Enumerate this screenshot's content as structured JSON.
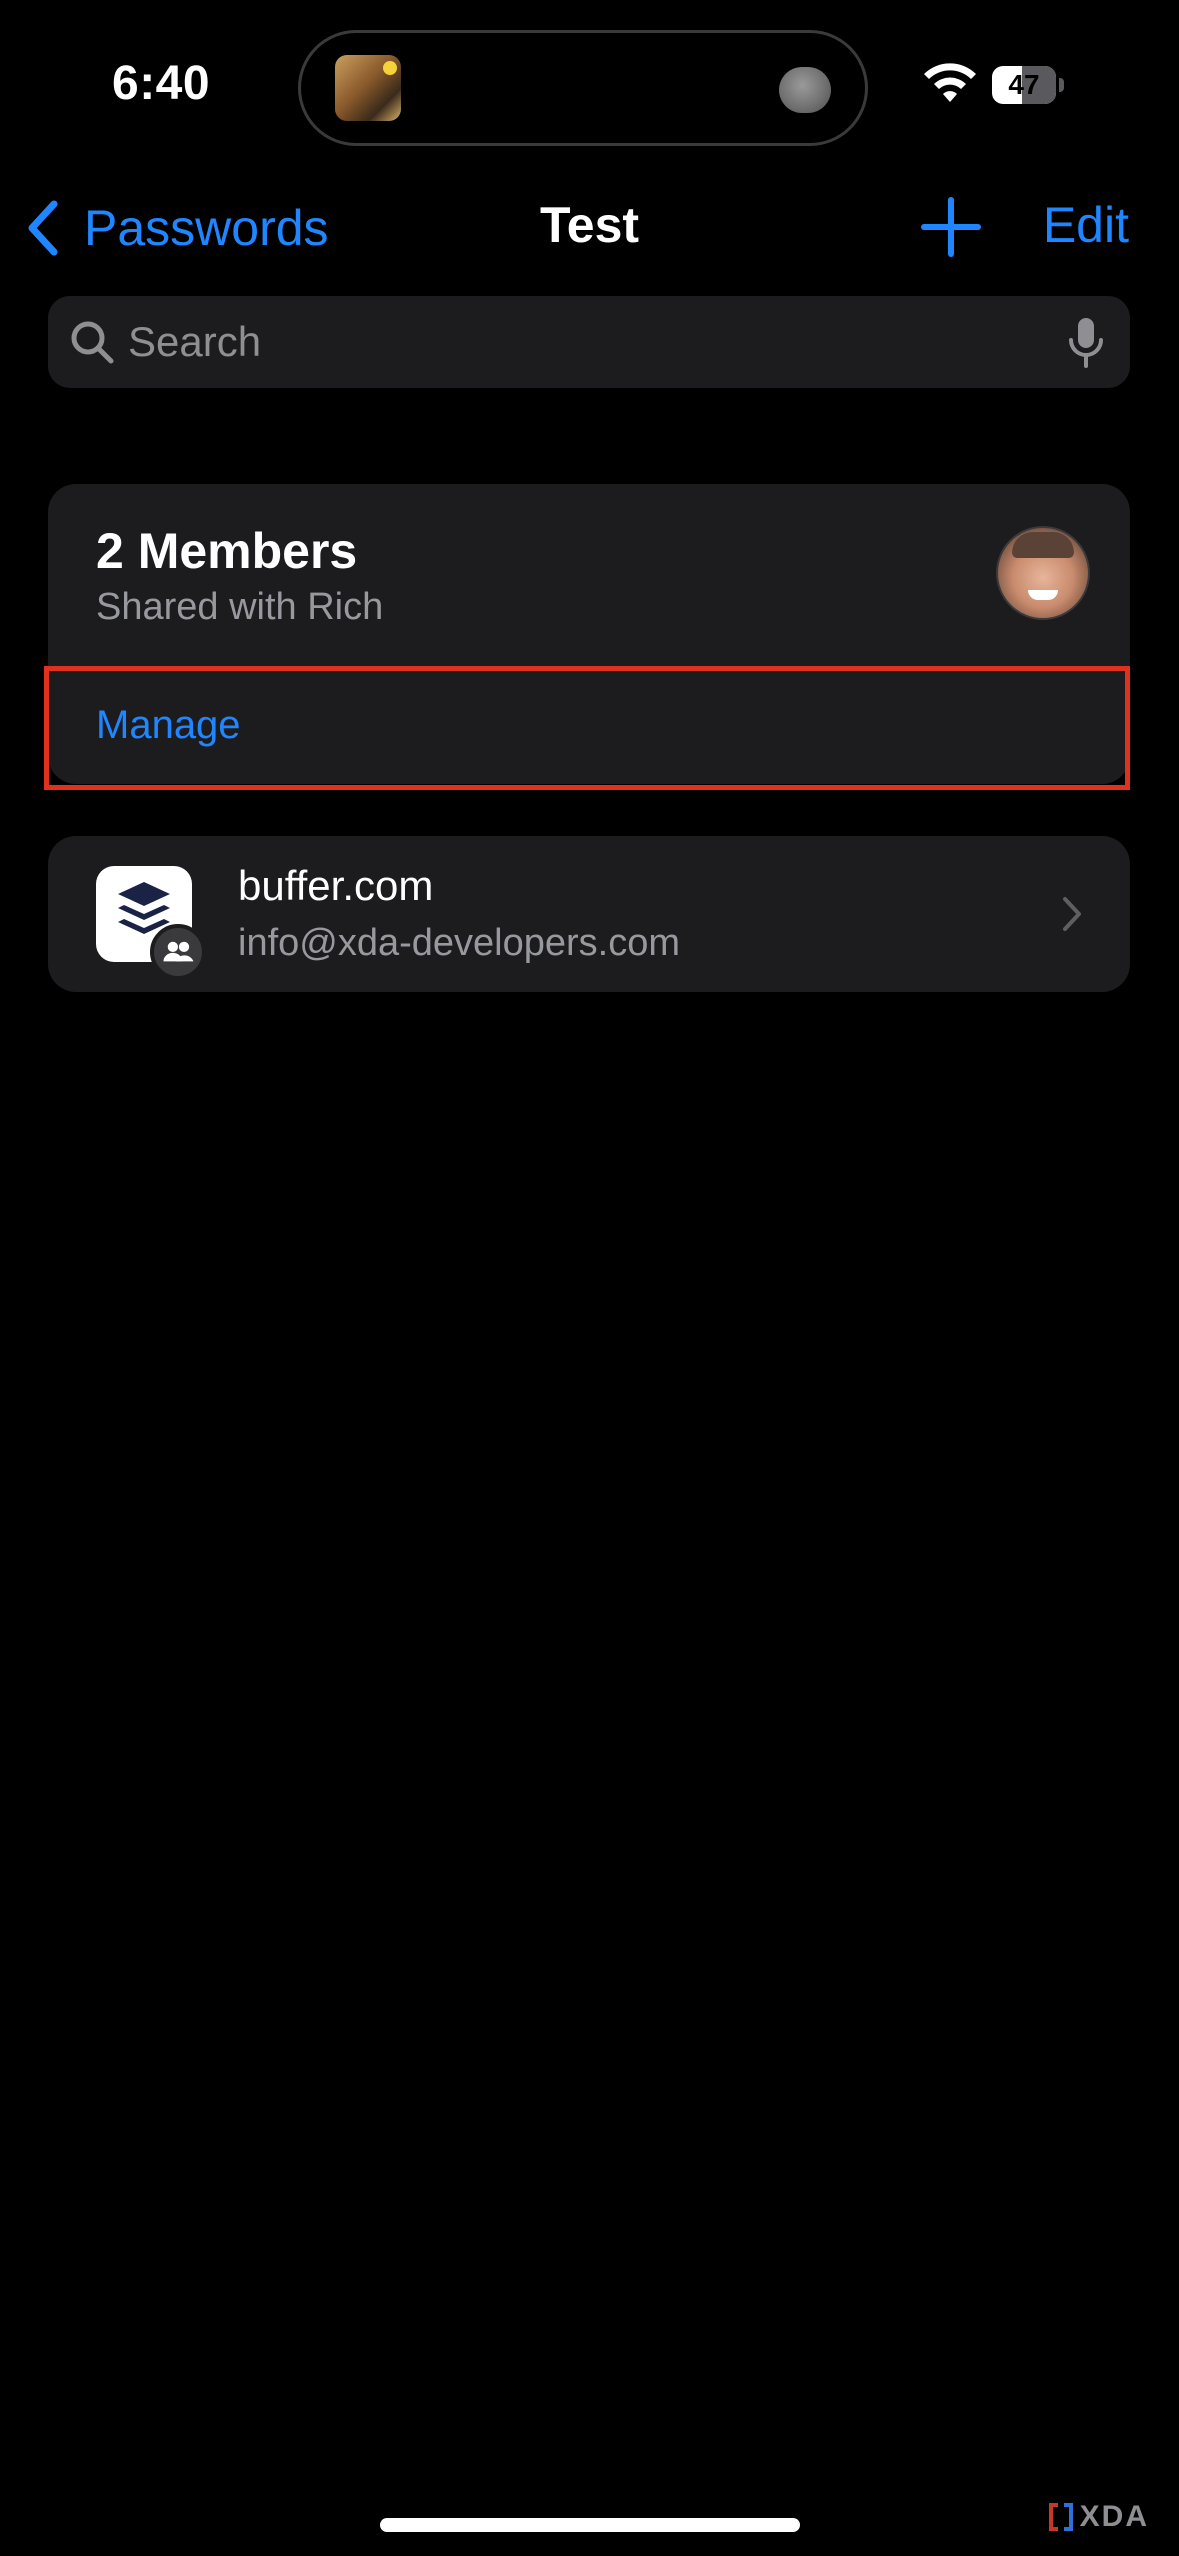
{
  "status_bar": {
    "time": "6:40",
    "battery": "47",
    "battery_level_percent": 47
  },
  "nav": {
    "back_label": "Passwords",
    "title": "Test",
    "edit_label": "Edit",
    "icons": {
      "back": "chevron-left-icon",
      "add": "plus-icon"
    }
  },
  "search": {
    "placeholder": "Search",
    "value": "",
    "icons": {
      "search": "search-icon",
      "dictation": "mic-icon"
    }
  },
  "members_card": {
    "title": "2 Members",
    "subtitle": "Shared with Rich",
    "action_label": "Manage"
  },
  "passwords": [
    {
      "site": "buffer.com",
      "account": "info@xda-developers.com",
      "icon": "buffer-logo-icon",
      "badge": "shared-group-icon"
    }
  ],
  "watermark": "XDA",
  "colors": {
    "accent": "#1f86ff",
    "card_background": "#1c1c1e",
    "secondary_text": "#98989f",
    "highlight": "#e0301e",
    "background": "#000000"
  }
}
